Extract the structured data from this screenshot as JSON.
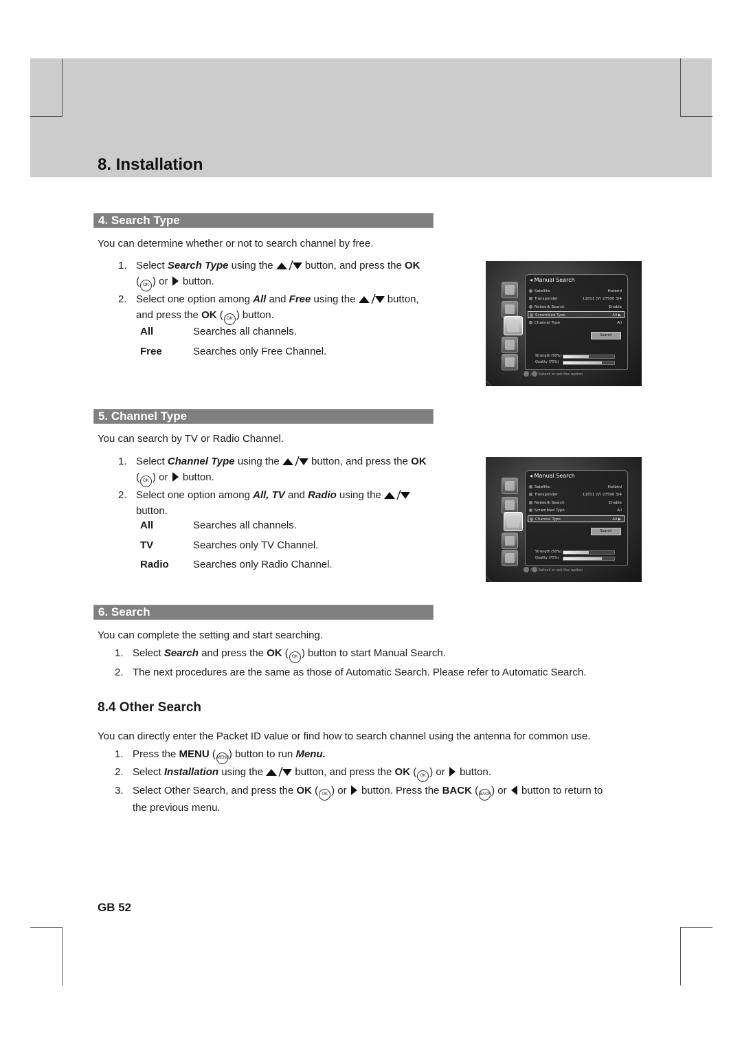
{
  "header": {
    "chapter_title": "8. Installation"
  },
  "sections": {
    "search_type": {
      "heading": "4. Search Type",
      "intro": "You can determine whether or not to search channel by free.",
      "step1": {
        "num": "1.",
        "a": "Select ",
        "em": "Search Type",
        "b": " using the ",
        "c": " button, and press the ",
        "ok": "OK",
        "d": " or ",
        "e": " button."
      },
      "step2": {
        "num": "2.",
        "a": "Select one option among ",
        "em1": "All",
        "b": " and ",
        "em2": "Free",
        "c": " using the ",
        "d": " button,",
        "e": "and press the ",
        "ok": "OK",
        "f": " button."
      },
      "options": [
        {
          "key": "All",
          "desc": "Searches all channels."
        },
        {
          "key": "Free",
          "desc": "Searches only Free Channel."
        }
      ]
    },
    "channel_type": {
      "heading": "5. Channel Type",
      "intro": "You can search by TV or Radio Channel.",
      "step1": {
        "num": "1.",
        "a": "Select ",
        "em": "Channel Type",
        "b": " using the ",
        "c": " button, and press the ",
        "ok": "OK",
        "d": " or ",
        "e": " button."
      },
      "step2": {
        "num": "2.",
        "a": "Select one option among ",
        "em1": "All, TV",
        "b": " and ",
        "em2": "Radio",
        "c": " using the ",
        "d": "button."
      },
      "options": [
        {
          "key": "All",
          "desc": "Searches all channels."
        },
        {
          "key": "TV",
          "desc": "Searches only TV Channel."
        },
        {
          "key": "Radio",
          "desc": "Searches only Radio Channel."
        }
      ]
    },
    "search": {
      "heading": "6. Search",
      "intro": "You can complete the setting and start searching.",
      "step1": {
        "num": "1.",
        "a": "Select ",
        "em": "Search",
        "b": " and press the ",
        "ok": "OK",
        "c": " button to start Manual Search."
      },
      "step2": {
        "num": "2.",
        "text": "The next procedures are the same as those of Automatic Search. Please refer to Automatic Search."
      }
    },
    "other_search": {
      "heading": "8.4 Other Search",
      "intro": "You can directly enter the Packet ID value or find how to search channel using the antenna for common use.",
      "step1": {
        "num": "1.",
        "a": "Press the ",
        "menu": "MENU",
        "b": " button to run ",
        "em": "Menu."
      },
      "step2": {
        "num": "2.",
        "a": "Select ",
        "em": "Installation",
        "b": " using the ",
        "c": " button, and press the ",
        "ok": "OK",
        "d": " or ",
        "e": " button."
      },
      "step3": {
        "num": "3.",
        "a": "Select Other Search, and press the ",
        "ok": "OK",
        "b": " or ",
        "c": " button. Press the ",
        "back": "BACK",
        "d": " or ",
        "e": " button to return to",
        "f": "the previous menu."
      }
    }
  },
  "keys": {
    "ok": "OK",
    "menu": "MENU",
    "back": "BACK"
  },
  "tv_screens": [
    {
      "title": "Manual Search",
      "rows": [
        {
          "num": "1",
          "label": "Satellite",
          "value": "Hotbird"
        },
        {
          "num": "2",
          "label": "Transponder",
          "value": "11811 (V) 27500 3/4"
        },
        {
          "num": "3",
          "label": "Network Search",
          "value": "Enable"
        },
        {
          "num": "4",
          "label": "Scrambled Type",
          "value": "All ▶"
        },
        {
          "num": "5",
          "label": "Channel Type",
          "value": "All"
        }
      ],
      "selected_row": 3,
      "search_button": "Search",
      "strength_label": "Strength (50%)",
      "strength": 0.5,
      "quality_label": "Quality (75%)",
      "quality": 0.75,
      "hint": "Select or set the option"
    },
    {
      "title": "Manual Search",
      "rows": [
        {
          "num": "1",
          "label": "Satellite",
          "value": "Hotbird"
        },
        {
          "num": "2",
          "label": "Transponder",
          "value": "11811 (V) 27500 3/4"
        },
        {
          "num": "3",
          "label": "Network Search",
          "value": "Enable"
        },
        {
          "num": "4",
          "label": "Scrambled Type",
          "value": "All"
        },
        {
          "num": "5",
          "label": "Channel Type",
          "value": "All ▶"
        }
      ],
      "selected_row": 4,
      "search_button": "Search",
      "strength_label": "Strength (50%)",
      "strength": 0.5,
      "quality_label": "Quality (75%)",
      "quality": 0.75,
      "hint": "Select or set the option"
    }
  ],
  "footer": {
    "page_number": "GB 52"
  }
}
